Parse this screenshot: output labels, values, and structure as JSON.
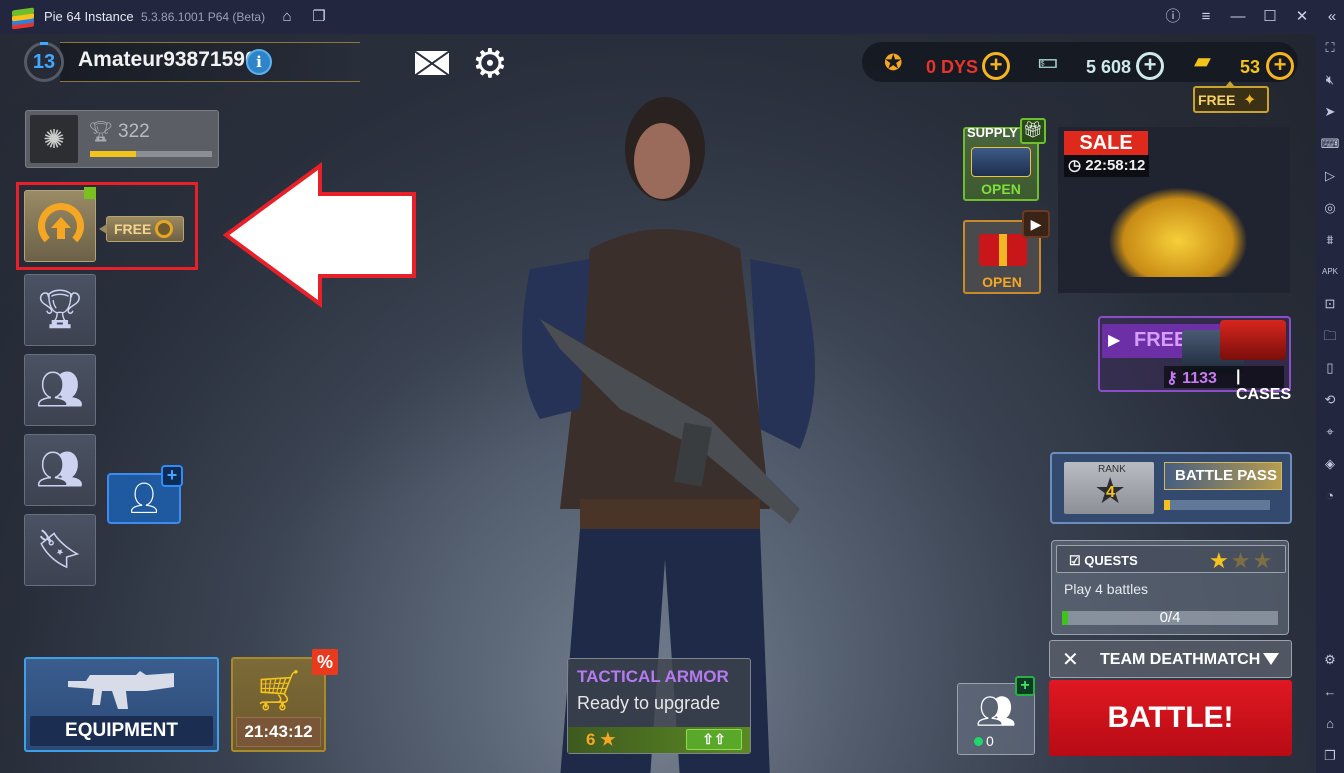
{
  "window": {
    "title": "Pie 64 Instance",
    "version": "5.3.86.1001 P64 (Beta)",
    "titlebar_icons": [
      "home-icon",
      "multi-instance-icon",
      "help-icon",
      "menu-icon",
      "minimize-icon",
      "maximize-icon",
      "close-icon",
      "collapse-sidebar-icon"
    ]
  },
  "sidebar": {
    "icons": [
      "fullscreen-icon",
      "volume-mute-icon",
      "pointer-icon",
      "keyboard-icon",
      "macro-record-icon",
      "rotate-sync-icon",
      "shake-icon",
      "install-apk-icon",
      "screenshot-icon",
      "folder-icon",
      "multi-screen-icon",
      "rotate-icon",
      "location-icon",
      "layers-icon",
      "performance-icon",
      "settings-icon",
      "back-icon",
      "home-icon",
      "recent-apps-icon"
    ]
  },
  "profile": {
    "level": "13",
    "username": "Amateur93871590",
    "info_icon": "i"
  },
  "rank": {
    "trophies": "322",
    "progress_fraction": 0.38
  },
  "elo_promo": {
    "label": "FREE"
  },
  "currency": {
    "dys": "0 DYS",
    "cash": "5 608",
    "gold": "53",
    "free_gold_label": "FREE"
  },
  "supply": {
    "label": "SUPPLY",
    "action": "OPEN"
  },
  "video_gift": {
    "action": "OPEN"
  },
  "sale": {
    "label": "SALE",
    "timer": "22:58:12"
  },
  "free_cases": {
    "label": "FREE",
    "keys": "1133",
    "separator": "|",
    "cases_label": "CASES"
  },
  "battle_pass": {
    "rank_label": "RANK",
    "rank": "4",
    "label": "BATTLE PASS",
    "progress_fraction": 0.06
  },
  "quests": {
    "label": "QUESTS",
    "stars_earned": 1,
    "stars_total": 3,
    "description": "Play 4 battles",
    "progress": "0/4"
  },
  "mode": {
    "selected": "TEAM DEATHMATCH"
  },
  "battle": {
    "label": "BATTLE!"
  },
  "squad": {
    "online_count": "0"
  },
  "upgrade": {
    "title": "TACTICAL ARMOR",
    "subtitle": "Ready to upgrade",
    "level": "6"
  },
  "equipment": {
    "label": "EQUIPMENT"
  },
  "shop": {
    "timer": "21:43:12",
    "badge": "%"
  },
  "colors": {
    "accent_gold": "#f5a623",
    "battle_red": "#d81420",
    "highlight_red": "#e8202a",
    "quest_green": "#3ec21e",
    "purple": "#b57af0"
  }
}
